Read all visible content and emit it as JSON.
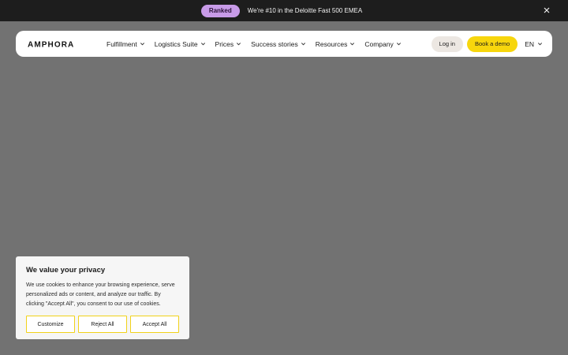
{
  "announcement": {
    "badge": "Ranked",
    "text": "We're #10 in the Deloitte Fast 500 EMEA"
  },
  "nav": {
    "logo": "AMPHORA",
    "menu": [
      {
        "label": "Fulfillment"
      },
      {
        "label": "Logistics Suite"
      },
      {
        "label": "Prices"
      },
      {
        "label": "Success stories"
      },
      {
        "label": "Resources"
      },
      {
        "label": "Company"
      }
    ],
    "login": "Log in",
    "demo": "Book a demo",
    "lang": "EN"
  },
  "colors": {
    "badge": "#c89be8",
    "demo_button": "#f7d60d",
    "cookie_button_border": "#f1d21a",
    "overlay": "#727272"
  },
  "cookie": {
    "title": "We value your privacy",
    "text": "We use cookies to enhance your browsing experience, serve personalized ads or content, and analyze our traffic. By clicking \"Accept All\", you consent to our use of cookies.",
    "customize": "Customize",
    "reject": "Reject All",
    "accept": "Accept All"
  }
}
